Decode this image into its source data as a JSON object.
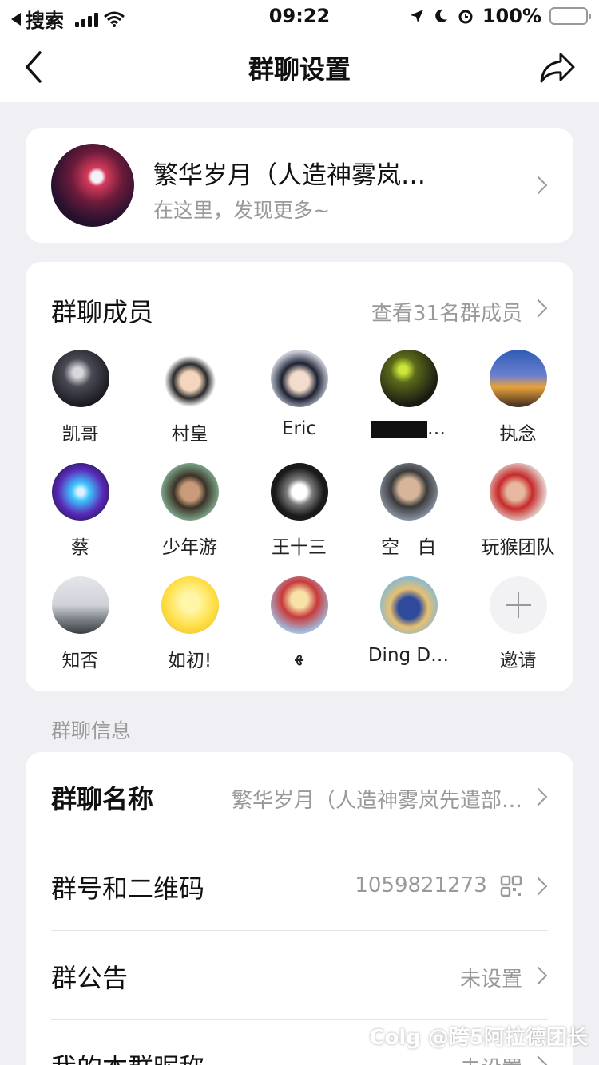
{
  "statusbar": {
    "back_app": "搜索",
    "time": "09:22",
    "battery": "100%",
    "battery_color": "#f6c500"
  },
  "nav": {
    "title": "群聊设置",
    "back_icon": "chevron-left-icon",
    "share_icon": "share-arrow-icon"
  },
  "group": {
    "name": "繁华岁月（人造神雾岚…",
    "subtitle": "在这里，发现更多~"
  },
  "members": {
    "title": "群聊成员",
    "view_all": "查看31名群成员",
    "list": [
      {
        "name": "凯哥"
      },
      {
        "name": "村皇"
      },
      {
        "name": "Eric"
      },
      {
        "name": "…"
      },
      {
        "name": "执念"
      },
      {
        "name": "蔡"
      },
      {
        "name": "少年游"
      },
      {
        "name": "王十三"
      },
      {
        "name": "空　白"
      },
      {
        "name": "玩猴团队"
      },
      {
        "name": "知否"
      },
      {
        "name": "如初!"
      },
      {
        "name": "ﻬ"
      },
      {
        "name": "Ding D…"
      },
      {
        "name": "邀请"
      }
    ]
  },
  "info": {
    "section_label": "群聊信息",
    "rows": [
      {
        "label": "群聊名称",
        "value": "繁华岁月（人造神雾岚先遣部…"
      },
      {
        "label": "群号和二维码",
        "value": "1059821273"
      },
      {
        "label": "群公告",
        "value": "未设置"
      },
      {
        "label": "我的本群昵称",
        "value": "未设置"
      }
    ]
  },
  "watermark": "Colg @跨5阿拉德团长",
  "accent_colors": {
    "background": "#efeff4",
    "card": "#ffffff",
    "secondary_text": "#999999"
  }
}
